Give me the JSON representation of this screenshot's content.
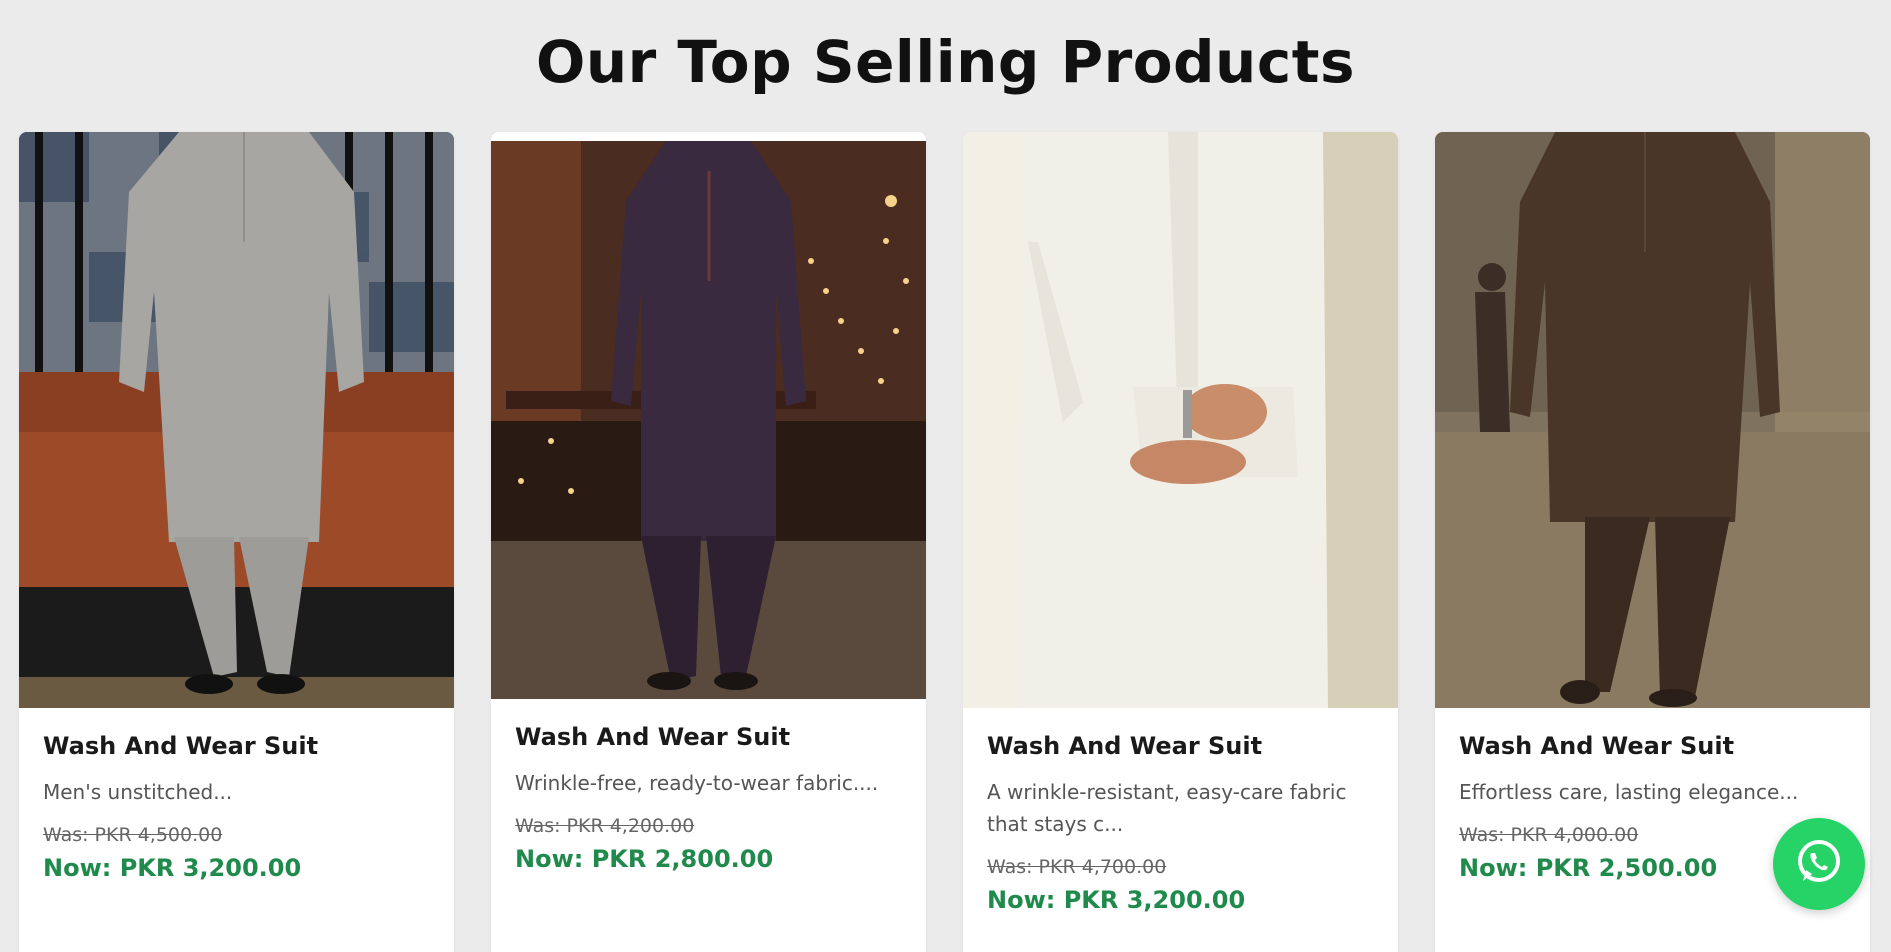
{
  "section": {
    "title": "Our Top Selling Products"
  },
  "products": [
    {
      "title": "Wash And Wear Suit",
      "description": "Men's unstitched...",
      "was": "Was: PKR 4,500.00",
      "now": "Now: PKR 3,200.00",
      "colors": {
        "suit": "#a7a6a3",
        "bg": "#8a3e22",
        "bg2": "#2a2a2a"
      }
    },
    {
      "title": "Wash And Wear Suit",
      "description": "Wrinkle-free, ready-to-wear fabric....",
      "was": "Was: PKR 4,200.00",
      "now": "Now: PKR 2,800.00",
      "colors": {
        "suit": "#3a2a40",
        "bg": "#4a2c20",
        "bg2": "#1e1410"
      }
    },
    {
      "title": "Wash And Wear Suit",
      "description": "A wrinkle-resistant, easy-care fabric that stays c...",
      "was": "Was: PKR 4,700.00",
      "now": "Now: PKR 3,200.00",
      "colors": {
        "suit": "#f0efe8",
        "bg": "#e9e3d2",
        "bg2": "#d8cfb9"
      }
    },
    {
      "title": "Wash And Wear Suit",
      "description": "Effortless care, lasting elegance...",
      "was": "Was: PKR 4,000.00",
      "now": "Now: PKR 2,500.00",
      "colors": {
        "suit": "#4a3628",
        "bg": "#8b7a62",
        "bg2": "#6f6352"
      }
    }
  ],
  "whatsapp": {
    "icon": "whatsapp-icon",
    "color": "#25d366"
  }
}
